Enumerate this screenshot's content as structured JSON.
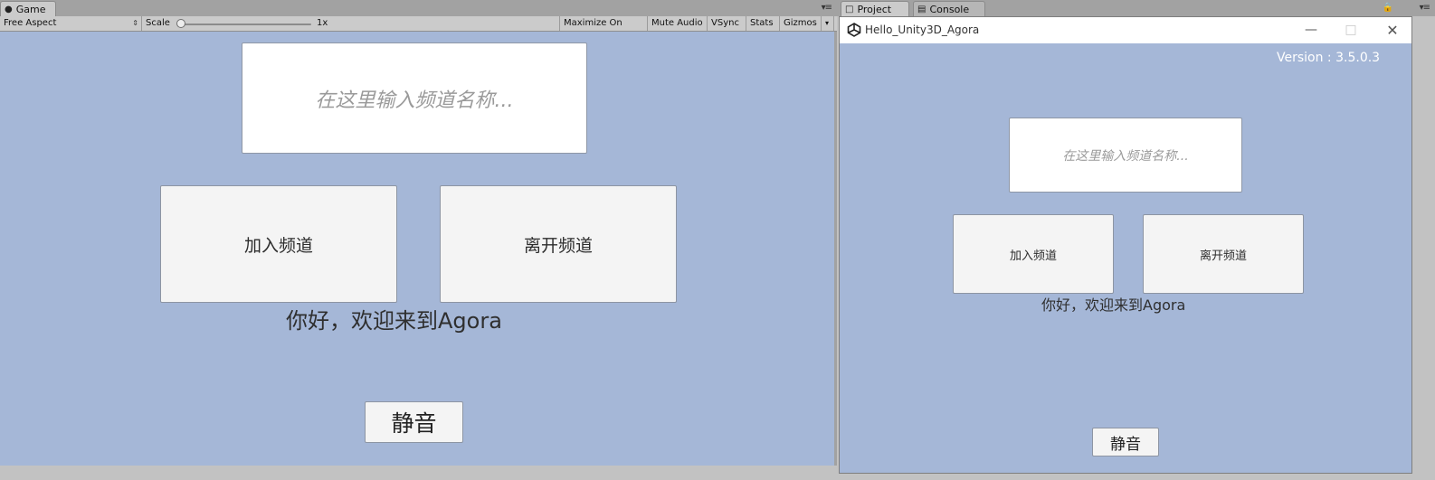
{
  "game_panel": {
    "tab_label": "Game",
    "toolbar": {
      "aspect": "Free Aspect",
      "scale_label": "Scale",
      "scale_value": "1x",
      "maximize_on_play": "Maximize On Play",
      "mute_audio": "Mute Audio",
      "vsync": "VSync",
      "stats": "Stats",
      "gizmos": "Gizmos"
    },
    "view": {
      "channel_placeholder": "在这里输入频道名称...",
      "join_button": "加入频道",
      "leave_button": "离开频道",
      "welcome_text": "你好，欢迎来到Agora",
      "mute_button": "静音"
    }
  },
  "right_panel": {
    "tabs": [
      "Project",
      "Console"
    ],
    "app_window": {
      "title": "Hello_Unity3D_Agora",
      "version": "Version : 3.5.0.3",
      "channel_placeholder": "在这里输入频道名称...",
      "join_button": "加入频道",
      "leave_button": "离开频道",
      "welcome_text": "你好，欢迎来到Agora",
      "mute_button": "静音"
    }
  },
  "colors": {
    "view_background": "#a5b7d7",
    "button_background": "#f4f4f4",
    "input_background": "#ffffff",
    "editor_toolbar": "#cbcbcb"
  }
}
